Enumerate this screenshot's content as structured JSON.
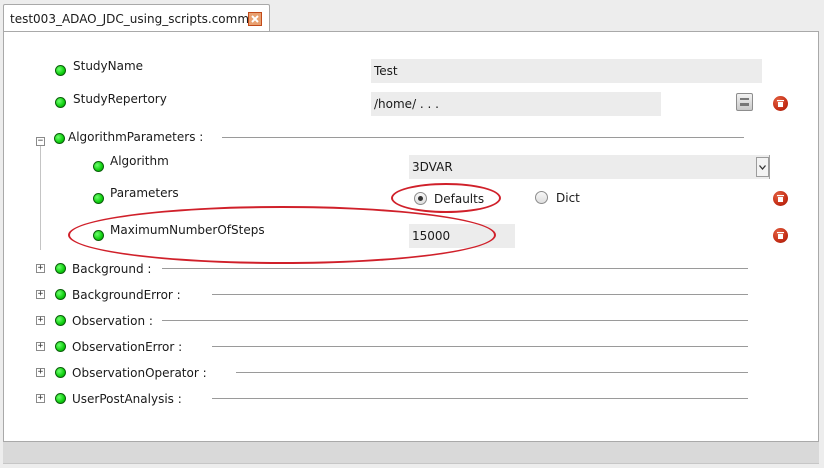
{
  "tab": {
    "title": "test003_ADAO_JDC_using_scripts.comm"
  },
  "study": {
    "name_label": "StudyName",
    "name_value": "Test",
    "repertory_label": "StudyRepertory",
    "repertory_value": "/home/ . . ."
  },
  "algorithm_parameters": {
    "group_label": "AlgorithmParameters :",
    "algorithm_label": "Algorithm",
    "algorithm_value": "3DVAR",
    "parameters_label": "Parameters",
    "radio_defaults": "Defaults",
    "radio_dict": "Dict",
    "selected": "Defaults",
    "max_steps_label": "MaximumNumberOfSteps",
    "max_steps_value": "15000"
  },
  "collapsed_groups": [
    "Background :",
    "BackgroundError :",
    "Observation :",
    "ObservationError :",
    "ObservationOperator :",
    "UserPostAnalysis :"
  ],
  "colors": {
    "status_ok": "#0fcf0f",
    "delete": "#c22b14",
    "highlight": "#d0202a"
  },
  "icons": {
    "status": "green-dot-icon",
    "delete": "trash-icon",
    "file": "file-browse-icon",
    "close": "close-icon",
    "expand": "plus-icon",
    "collapse": "minus-icon"
  }
}
